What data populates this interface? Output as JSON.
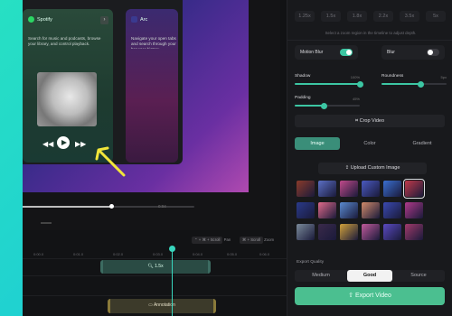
{
  "preview": {
    "spotify_card": {
      "title": "Spotify",
      "description": "Search for music and podcasts, browse your library, and control playback."
    },
    "arc_card": {
      "title": "Arc",
      "description": "Navigate your open tabs and search through your browser history."
    },
    "scrub": {
      "time": "0:04",
      "progress": 0.52
    }
  },
  "timeline": {
    "hints": [
      {
        "keys": "⌃ + ⌘ + Scroll",
        "action": "Pan"
      },
      {
        "keys": "⌘ + Scroll",
        "action": "Zoom"
      }
    ],
    "ruler_ticks": [
      "0:00.0",
      "0:01.0",
      "0:02.0",
      "0:03.0",
      "0:04.0",
      "0:05.0",
      "0:06.0"
    ],
    "zoom_clip_label": "1.5x",
    "annotation_clip_label": "Annotation"
  },
  "panel": {
    "zoom_levels": [
      "1.25x",
      "1.5x",
      "1.8x",
      "2.2x",
      "3.5x",
      "5x"
    ],
    "zoom_hint": "Select a zoom region in the timeline to adjust depth.",
    "motion_blur": {
      "label": "Motion Blur",
      "enabled": true
    },
    "blur": {
      "label": "Blur",
      "enabled": false
    },
    "shadow": {
      "label": "Shadow",
      "value_text": "100%",
      "value": 1.0
    },
    "roundness": {
      "label": "Roundness",
      "value_text": "5px",
      "value": 0.6
    },
    "padding": {
      "label": "Padding",
      "value_text": "45%",
      "value": 0.45
    },
    "crop_label": "Crop Video",
    "bg_tabs": [
      "Image",
      "Color",
      "Gradient"
    ],
    "active_bg_tab": "Image",
    "upload_label": "Upload Custom Image",
    "wallpaper_colors": [
      [
        "#8a3b2a",
        "#5b6fc4",
        "#c04a8a",
        "#4a5ac0",
        "#3a6fd0",
        "#c03a4a"
      ],
      [
        "#2a3a8a",
        "#e06a8a",
        "#5a8ad0",
        "#d08a6a",
        "#3a4ab0",
        "#b03a8a"
      ],
      [
        "#7a8a9a",
        "#3a2a4a",
        "#d0a03a",
        "#c05a9a",
        "#5a4ac0",
        "#a03a6a"
      ]
    ],
    "selected_wallpaper": "0-5",
    "export_quality_label": "Export Quality",
    "quality_options": [
      "Medium",
      "Good",
      "Source"
    ],
    "active_quality": "Good",
    "export_label": "Export Video",
    "accent_color": "#3cc6a3"
  }
}
